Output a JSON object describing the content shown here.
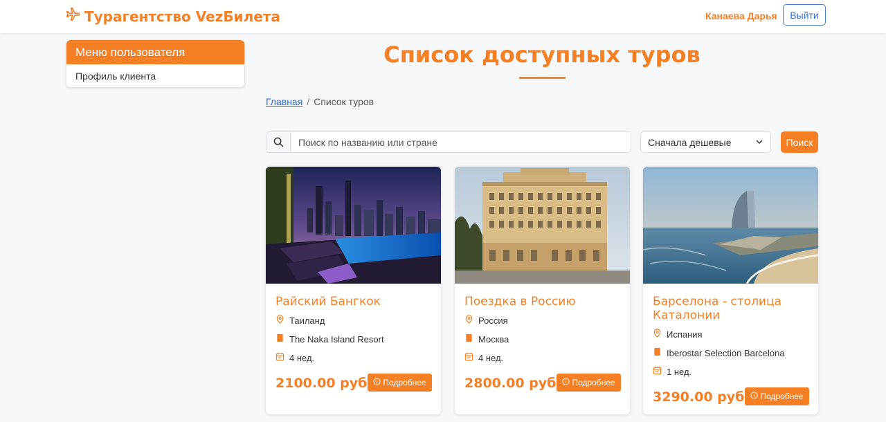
{
  "header": {
    "brand": "Турагентство VezБилета",
    "user_name": "Канаева Дарья",
    "logout_label": "Выйти"
  },
  "sidebar": {
    "title": "Меню пользователя",
    "items": [
      {
        "label": "Профиль клиента"
      }
    ]
  },
  "main": {
    "title": "Список доступных туров",
    "breadcrumb": {
      "home": "Главная",
      "separator": "/",
      "current": "Список туров"
    },
    "search": {
      "placeholder": "Поиск по названию или стране",
      "value": ""
    },
    "sort": {
      "selected": "Сначала дешевые"
    },
    "search_button": "Поиск"
  },
  "tours": [
    {
      "title": "Райский Бангкок",
      "country": "Таиланд",
      "hotel": "The Naka Island Resort",
      "duration": "4 нед.",
      "price": "2100.00 руб.",
      "button": "Подробнее"
    },
    {
      "title": "Поездка в Россию",
      "country": "Россия",
      "hotel": "Москва",
      "duration": "4 нед.",
      "price": "2800.00 руб.",
      "button": "Подробнее"
    },
    {
      "title": "Барселона - столица Каталонии",
      "country": "Испания",
      "hotel": "Iberostar Selection Barcelona",
      "duration": "1 нед.",
      "price": "3290.00 руб.",
      "button": "Подробнее"
    }
  ],
  "colors": {
    "accent": "#f57f24",
    "link": "#2a6bd6",
    "background": "#f6f7f9"
  },
  "icons": {
    "brand": "plane-icon",
    "search": "search-icon",
    "sort": "chevron-down-icon",
    "country": "map-pin-icon",
    "hotel": "bookmark-icon",
    "duration": "calendar-icon",
    "details": "info-circle-icon"
  }
}
